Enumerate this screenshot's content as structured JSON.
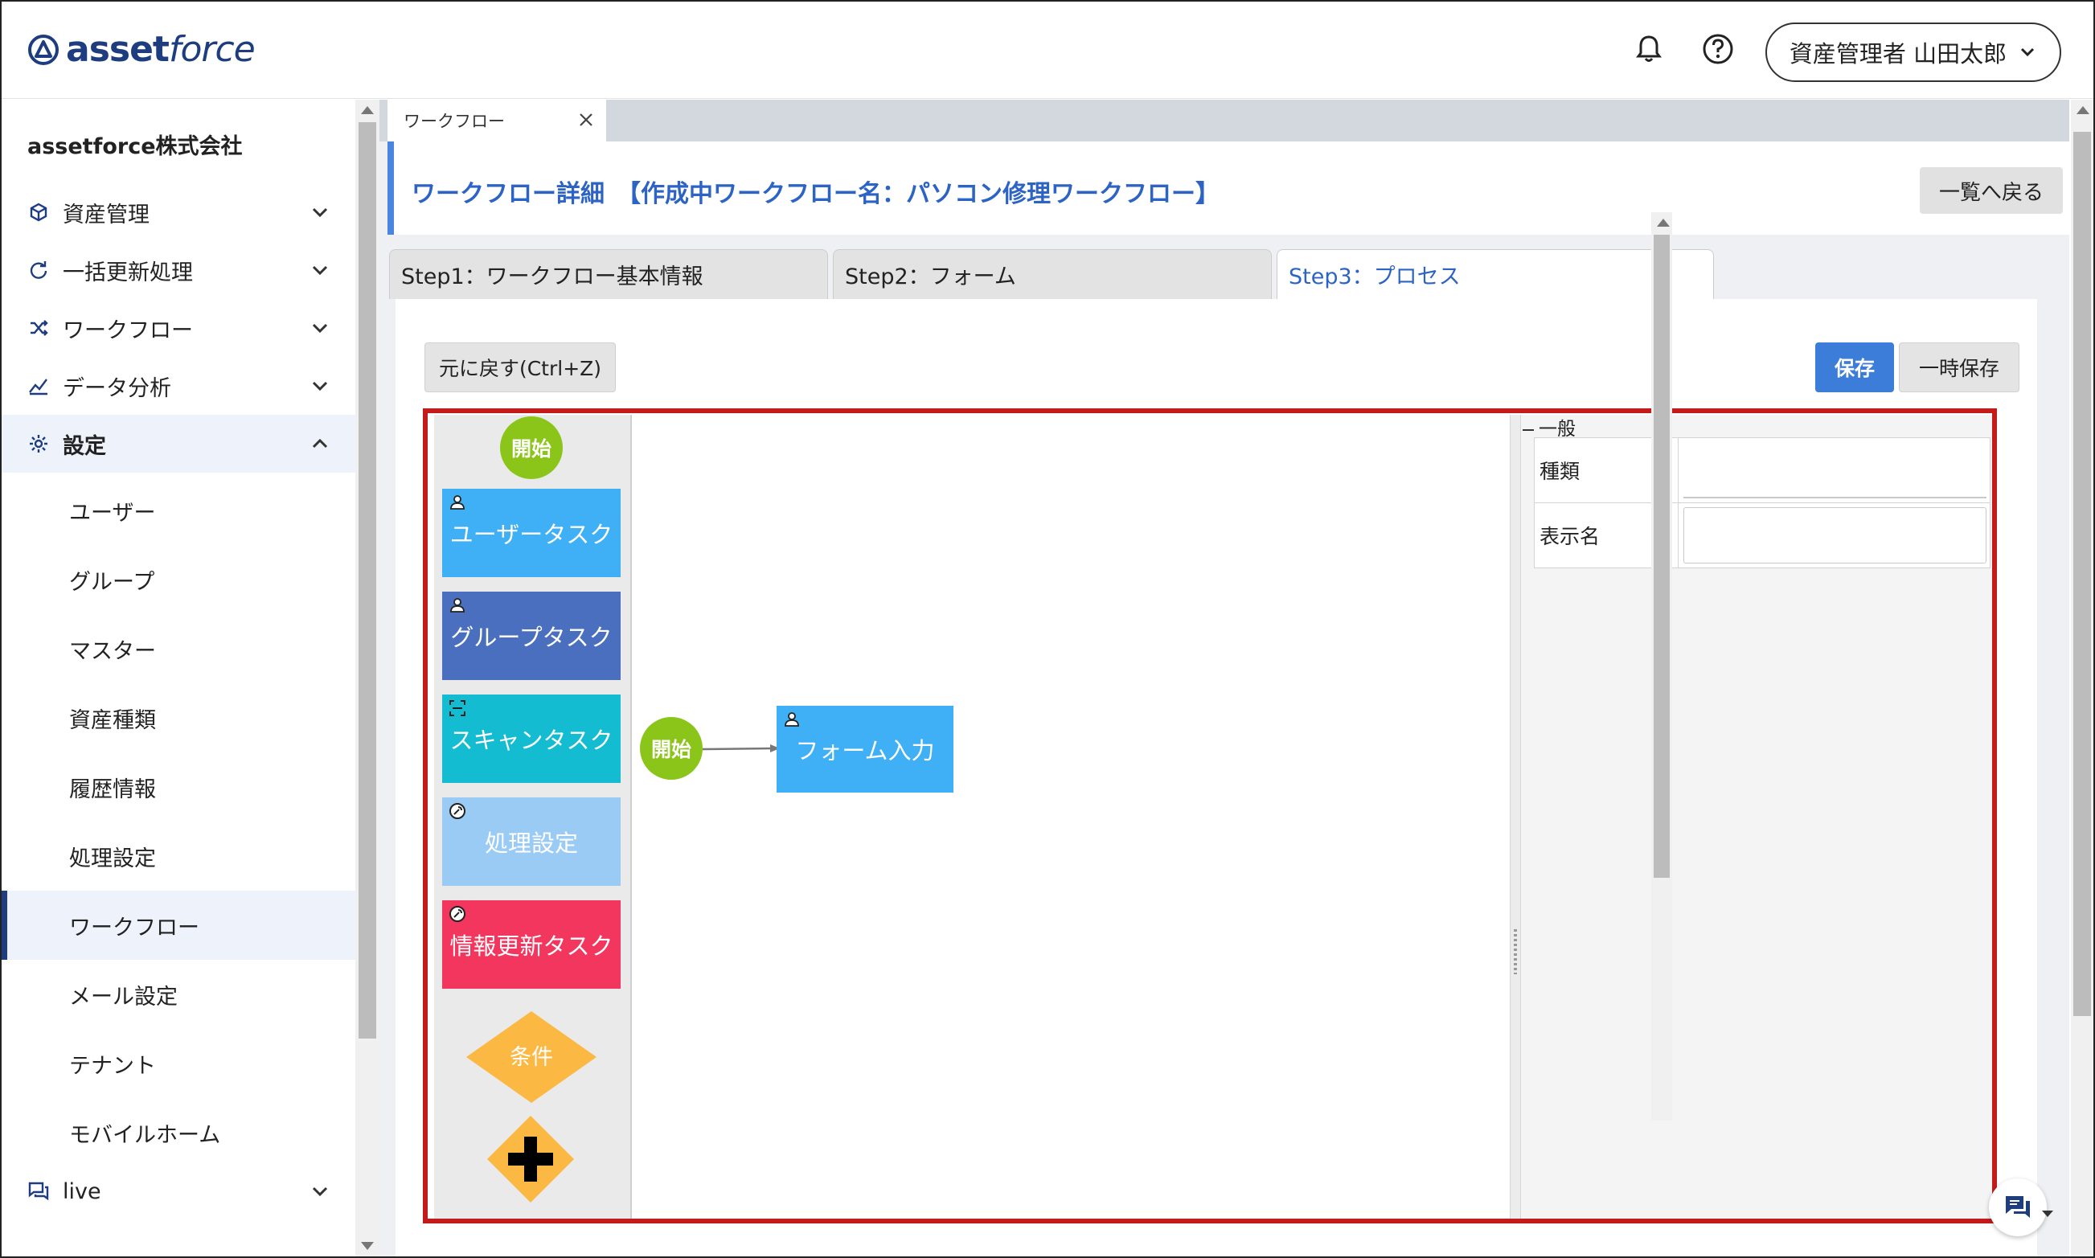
{
  "header": {
    "logo_bold": "asset",
    "logo_light": "force",
    "user_label": "資産管理者 山田太郎"
  },
  "sidebar": {
    "company": "assetforce株式会社",
    "items": [
      {
        "label": "資産管理",
        "icon": "cube-icon"
      },
      {
        "label": "一括更新処理",
        "icon": "refresh-icon"
      },
      {
        "label": "ワークフロー",
        "icon": "shuffle-icon"
      },
      {
        "label": "データ分析",
        "icon": "chart-icon"
      },
      {
        "label": "設定",
        "icon": "gear-icon"
      }
    ],
    "sub_items": [
      "ユーザー",
      "グループ",
      "マスター",
      "資産種類",
      "履歴情報",
      "処理設定",
      "ワークフロー",
      "メール設定",
      "テナント",
      "モバイルホーム"
    ],
    "active_sub": "ワークフロー",
    "bottom_item": {
      "label": "live",
      "icon": "chat-icon"
    }
  },
  "tabs": {
    "doc_tab": "ワークフロー"
  },
  "page": {
    "title": "ワークフロー詳細　【作成中ワークフロー名：パソコン修理ワークフロー】",
    "back_button": "一覧へ戻る"
  },
  "steps": [
    {
      "label": "Step1：ワークフロー基本情報",
      "active": false
    },
    {
      "label": "Step2：フォーム",
      "active": false
    },
    {
      "label": "Step3：プロセス",
      "active": true
    }
  ],
  "toolbar": {
    "undo": "元に戻す(Ctrl+Z)",
    "save": "保存",
    "temp_save": "一時保存"
  },
  "palette": {
    "start": "開始",
    "user_task": "ユーザータスク",
    "group_task": "グループタスク",
    "scan_task": "スキャンタスク",
    "process_setting": "処理設定",
    "info_update_task": "情報更新タスク",
    "condition": "条件"
  },
  "canvas": {
    "start": "開始",
    "task": "フォーム入力"
  },
  "properties": {
    "section": "一般",
    "rows": [
      {
        "label": "種類",
        "value": ""
      },
      {
        "label": "表示名",
        "value": ""
      }
    ]
  },
  "colors": {
    "brand": "#1d3d80",
    "accent": "#3b7dd8",
    "start_green": "#8bc51a",
    "user_task": "#3fb0f5",
    "group_task": "#4a6fbf",
    "scan_task": "#14bcd2",
    "process_setting": "#9acbf5",
    "info_update_task": "#f2365e",
    "condition": "#fbb843",
    "editor_border": "#c41a1a"
  }
}
